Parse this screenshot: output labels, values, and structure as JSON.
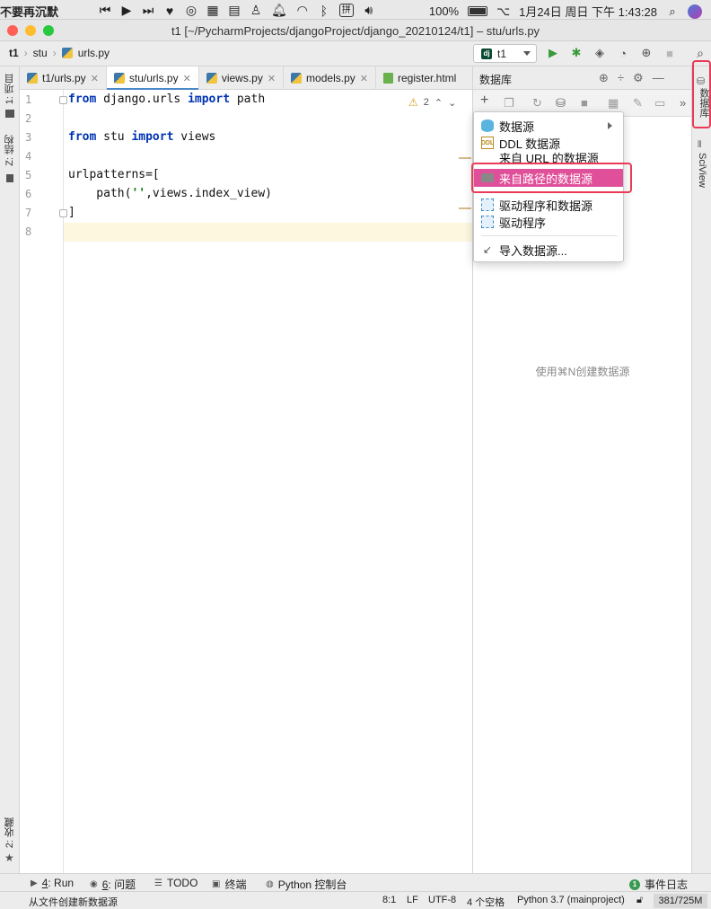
{
  "menubar": {
    "song": "不要再沉默",
    "battery": "100%",
    "input_method": "拼",
    "datetime": "1月24日 周日 下午 1:43:28"
  },
  "window": {
    "title": "t1 [~/PycharmProjects/djangoProject/django_20210124/t1] – stu/urls.py"
  },
  "breadcrumb": [
    "t1",
    "stu",
    "urls.py"
  ],
  "run_config": "t1",
  "left_tools": [
    "1: 项目",
    "Z: 结构",
    "2: 收藏"
  ],
  "right_tools": [
    "数据库",
    "SciView"
  ],
  "tabs": [
    {
      "label": "t1/urls.py",
      "icon": "python-file-icon",
      "active": false
    },
    {
      "label": "stu/urls.py",
      "icon": "python-file-icon",
      "active": true
    },
    {
      "label": "views.py",
      "icon": "python-file-icon",
      "active": false
    },
    {
      "label": "models.py",
      "icon": "python-file-icon",
      "active": false
    },
    {
      "label": "register.html",
      "icon": "html-file-icon",
      "active": false
    }
  ],
  "editor": {
    "warnings_count": "2",
    "line_numbers": [
      "1",
      "2",
      "3",
      "4",
      "5",
      "6",
      "7",
      "8"
    ],
    "code": {
      "l1_kw1": "from",
      "l1_mod": " django.urls ",
      "l1_kw2": "import",
      "l1_name": " path",
      "l3_kw1": "from",
      "l3_mod": " stu ",
      "l3_kw2": "import",
      "l3_name": " views",
      "l5": "urlpatterns=[",
      "l6_pre": "    path(",
      "l6_str": "''",
      "l6_post": ",views.index_view)",
      "l7": "]"
    }
  },
  "db_panel": {
    "title": "数据库",
    "empty_hint": "使用⌘N创建数据源"
  },
  "dropdown": {
    "items": [
      {
        "label": "数据源",
        "icon": "datasource-icon",
        "submenu": true
      },
      {
        "label": "DDL 数据源",
        "icon": "ddl-icon",
        "icon_text": "DDL"
      },
      {
        "label": "来自 URL 的数据源",
        "icon": "url-icon"
      },
      {
        "label": "来自路径的数据源",
        "icon": "folder-icon",
        "selected": true
      },
      {
        "label": "驱动程序和数据源",
        "icon": "driver-icon"
      },
      {
        "label": "驱动程序",
        "icon": "driver-icon"
      },
      {
        "label": "导入数据源...",
        "icon": "import-icon"
      }
    ]
  },
  "bottom_tools": [
    {
      "key": "4",
      "label": ": Run"
    },
    {
      "key": "6",
      "label": ": 问题"
    },
    {
      "key": "",
      "label": "TODO"
    },
    {
      "key": "",
      "label": "终端"
    },
    {
      "key": "",
      "label": "Python 控制台"
    }
  ],
  "event_log": {
    "badge": "1",
    "label": "事件日志"
  },
  "status": {
    "message": "从文件创建新数据源",
    "position": "8:1",
    "line_sep": "LF",
    "encoding": "UTF-8",
    "indent": "4 个空格",
    "interpreter": "Python 3.7 (mainproject)",
    "memory": "381/725M"
  },
  "colors": {
    "selection": "#e0509a",
    "highlight_box": "#ea3a55",
    "keyword": "#0033b3",
    "string": "#067d17"
  }
}
